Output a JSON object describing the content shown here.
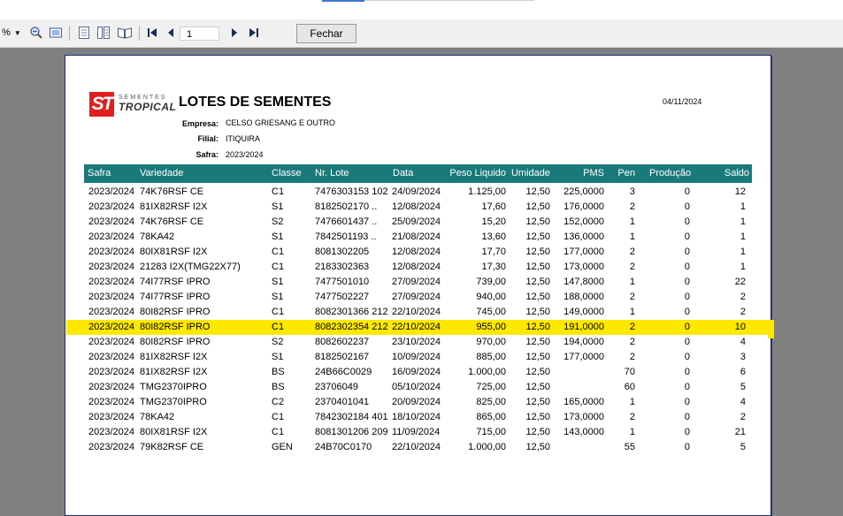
{
  "toolbar": {
    "zoom": "%",
    "page_number": "1",
    "close_label": "Fechar"
  },
  "report": {
    "logo_top": "SEMENTES",
    "logo_main": "TROPICAL",
    "logo_mark": "ST",
    "title": "LOTES DE SEMENTES",
    "date": "04/11/2024",
    "empresa_label": "Empresa:",
    "empresa": "CELSO GRIESANG E OUTRO",
    "filial_label": "Filial:",
    "filial": "ITIQUIRA",
    "safra_label": "Safra:",
    "safra": "2023/2024"
  },
  "columns": [
    "Safra",
    "Variedade",
    "Classe",
    "Nr. Lote",
    "Data",
    "Peso Liquido",
    "Umidade",
    "PMS",
    "Pen",
    "Produção",
    "Saldo"
  ],
  "rows": [
    [
      "2023/2024",
      "74K76RSF CE",
      "C1",
      "7476303153  102",
      "24/09/2024",
      "1.125,00",
      "12,50",
      "225,0000",
      "3",
      "0",
      "12"
    ],
    [
      "2023/2024",
      "81IX82RSF I2X",
      "S1",
      "8182502170  ..",
      "12/08/2024",
      "17,60",
      "12,50",
      "176,0000",
      "2",
      "0",
      "1"
    ],
    [
      "2023/2024",
      "74K76RSF CE",
      "S2",
      "7476601437  ..",
      "25/09/2024",
      "15,20",
      "12,50",
      "152,0000",
      "1",
      "0",
      "1"
    ],
    [
      "2023/2024",
      "78KA42",
      "S1",
      "7842501193  ..",
      "21/08/2024",
      "13,60",
      "12,50",
      "136,0000",
      "1",
      "0",
      "1"
    ],
    [
      "2023/2024",
      "80IX81RSF I2X",
      "C1",
      "8081302205",
      "12/08/2024",
      "17,70",
      "12,50",
      "177,0000",
      "2",
      "0",
      "1"
    ],
    [
      "2023/2024",
      "21283 I2X(TMG22X77)",
      "C1",
      "2183302363",
      "12/08/2024",
      "17,30",
      "12,50",
      "173,0000",
      "2",
      "0",
      "1"
    ],
    [
      "2023/2024",
      "74I77RSF IPRO",
      "S1",
      "7477501010",
      "27/09/2024",
      "739,00",
      "12,50",
      "147,8000",
      "1",
      "0",
      "22"
    ],
    [
      "2023/2024",
      "74I77RSF IPRO",
      "S1",
      "7477502227",
      "27/09/2024",
      "940,00",
      "12,50",
      "188,0000",
      "2",
      "0",
      "2"
    ],
    [
      "2023/2024",
      "80I82RSF IPRO",
      "C1",
      "8082301366  212",
      "22/10/2024",
      "745,00",
      "12,50",
      "149,0000",
      "1",
      "0",
      "2"
    ],
    [
      "2023/2024",
      "80I82RSF IPRO",
      "C1",
      "8082302354  212",
      "22/10/2024",
      "955,00",
      "12,50",
      "191,0000",
      "2",
      "0",
      "10"
    ],
    [
      "2023/2024",
      "80I82RSF IPRO",
      "S2",
      "8082602237",
      "23/10/2024",
      "970,00",
      "12,50",
      "194,0000",
      "2",
      "0",
      "4"
    ],
    [
      "2023/2024",
      "81IX82RSF I2X",
      "S1",
      "8182502167",
      "10/09/2024",
      "885,00",
      "12,50",
      "177,0000",
      "2",
      "0",
      "3"
    ],
    [
      "2023/2024",
      "81IX82RSF I2X",
      "BS",
      "24B66C0029",
      "16/09/2024",
      "1.000,00",
      "12,50",
      "",
      "70",
      "0",
      "6"
    ],
    [
      "2023/2024",
      "TMG2370IPRO",
      "BS",
      "23706049",
      "05/10/2024",
      "725,00",
      "12,50",
      "",
      "60",
      "0",
      "5"
    ],
    [
      "2023/2024",
      "TMG2370IPRO",
      "C2",
      "2370401041",
      "20/09/2024",
      "825,00",
      "12,50",
      "165,0000",
      "1",
      "0",
      "4"
    ],
    [
      "2023/2024",
      "78KA42",
      "C1",
      "7842302184  401",
      "18/10/2024",
      "865,00",
      "12,50",
      "173,0000",
      "2",
      "0",
      "2"
    ],
    [
      "2023/2024",
      "80IX81RSF I2X",
      "C1",
      "8081301206  209",
      "11/09/2024",
      "715,00",
      "12,50",
      "143,0000",
      "1",
      "0",
      "21"
    ],
    [
      "2023/2024",
      "79K82RSF CE",
      "GEN",
      "24B70C0170",
      "22/10/2024",
      "1.000,00",
      "12,50",
      "",
      "55",
      "0",
      "5"
    ]
  ],
  "highlight_row": 9,
  "colors": {
    "header_bg": "#1a7a7a",
    "highlight": "#ffe800",
    "logo_red": "#e02020"
  }
}
